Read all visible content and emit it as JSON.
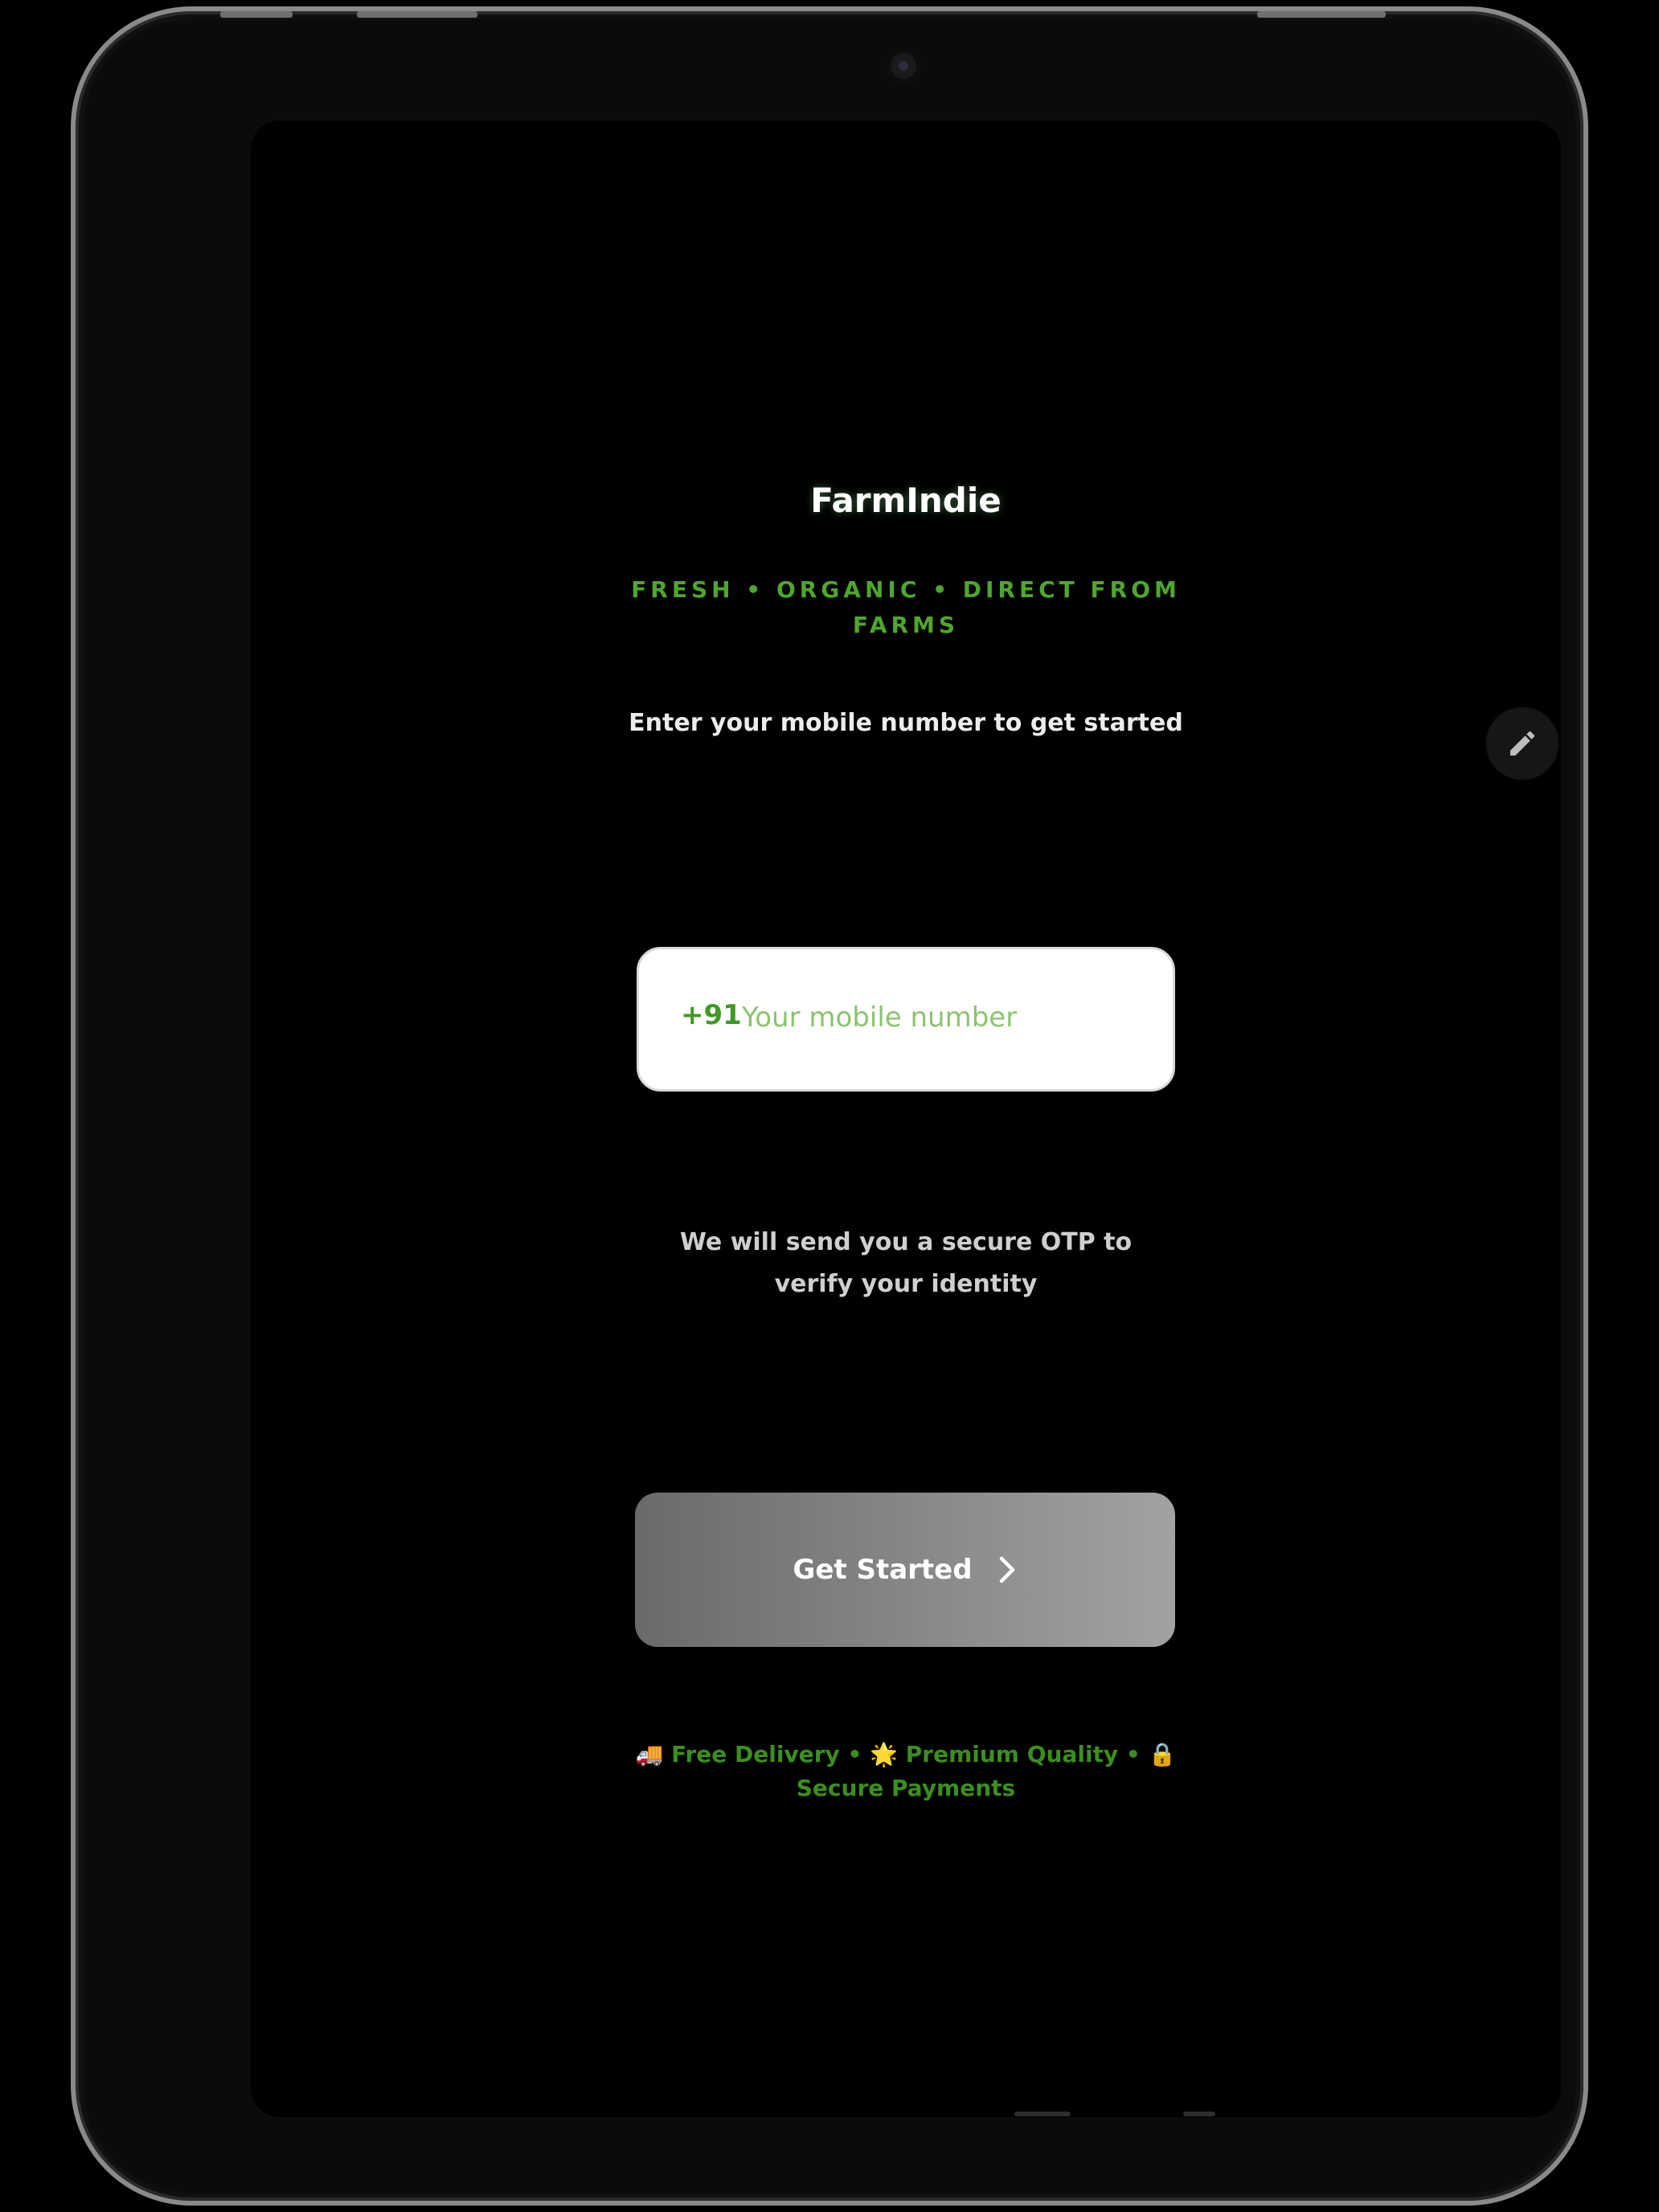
{
  "app": {
    "title": "FarmIndie",
    "tagline": "FRESH • ORGANIC • DIRECT FROM FARMS",
    "subtitle": "Enter your mobile number to get started"
  },
  "phone_input": {
    "country_code": "+91",
    "placeholder": "Your mobile number",
    "value": ""
  },
  "otp_note": "We will send you a secure OTP to verify your identity",
  "cta": {
    "label": "Get Started",
    "icon": "chevron-right-icon"
  },
  "features": {
    "text": "🚚 Free Delivery • 🌟 Premium Quality • 🔒 Secure Payments"
  },
  "floating_action": {
    "icon": "pencil-icon"
  },
  "colors": {
    "accent_green": "#4ea62e",
    "background": "#000000",
    "button_gradient_start": "#6a6a6a",
    "button_gradient_end": "#a2a2a2"
  }
}
